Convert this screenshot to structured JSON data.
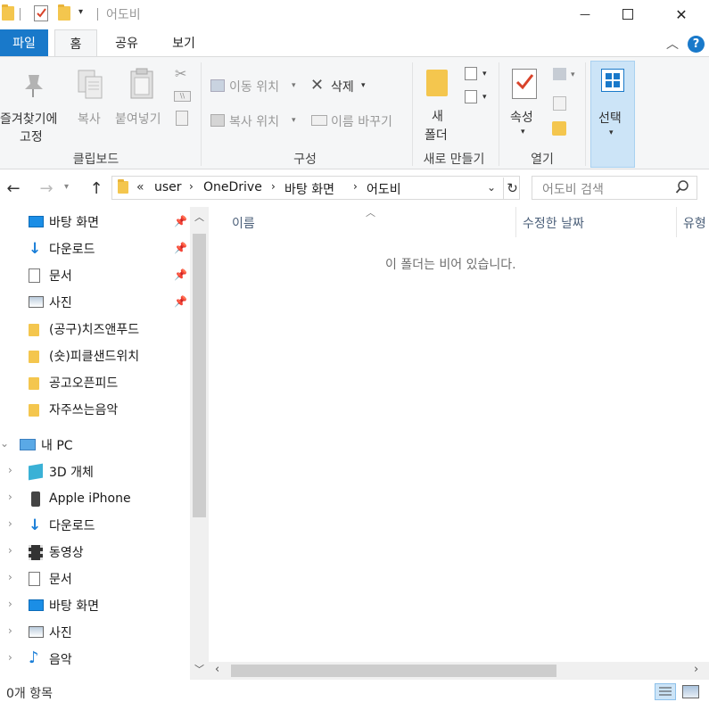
{
  "window": {
    "title": "어도비",
    "minimize_glyph": "—",
    "maximize_glyph": "☐",
    "close_glyph": "✕"
  },
  "tabs": {
    "file": "파일",
    "home": "홈",
    "share": "공유",
    "view": "보기"
  },
  "ribbon": {
    "clipboard": {
      "pin_quick": "즐겨찾기에",
      "pin_quick2": "고정",
      "copy": "복사",
      "paste": "붙여넣기",
      "group_label": "클립보드"
    },
    "organize": {
      "move_to": "이동 위치",
      "copy_to": "복사 위치",
      "delete": "삭제",
      "rename": "이름 바꾸기",
      "group_label": "구성"
    },
    "new": {
      "new_folder_1": "새",
      "new_folder_2": "폴더",
      "group_label": "새로 만들기"
    },
    "open": {
      "properties": "속성",
      "group_label": "열기"
    },
    "select": {
      "select": "선택"
    }
  },
  "address": {
    "overflow": "«",
    "crumbs": [
      "user",
      "OneDrive",
      "바탕 화면",
      "어도비"
    ],
    "search_placeholder": "어도비 검색"
  },
  "nav": {
    "quick": [
      {
        "label": "바탕 화면",
        "icon": "desktop-icon",
        "pinned": true
      },
      {
        "label": "다운로드",
        "icon": "download-icon",
        "pinned": true
      },
      {
        "label": "문서",
        "icon": "document-icon",
        "pinned": true
      },
      {
        "label": "사진",
        "icon": "pictures-icon",
        "pinned": true
      },
      {
        "label": "(공구)치즈앤푸드",
        "icon": "folder-icon",
        "pinned": false
      },
      {
        "label": "(숏)피클샌드위치",
        "icon": "folder-icon",
        "pinned": false
      },
      {
        "label": "공고오픈피드",
        "icon": "folder-icon",
        "pinned": false
      },
      {
        "label": "자주쓰는음악",
        "icon": "folder-icon",
        "pinned": false
      }
    ],
    "this_pc": "내 PC",
    "pc_items": [
      {
        "label": "3D 개체",
        "icon": "3d-objects-icon"
      },
      {
        "label": "Apple iPhone",
        "icon": "iphone-icon"
      },
      {
        "label": "다운로드",
        "icon": "download-icon"
      },
      {
        "label": "동영상",
        "icon": "video-icon"
      },
      {
        "label": "문서",
        "icon": "document-icon"
      },
      {
        "label": "바탕 화면",
        "icon": "desktop-icon"
      },
      {
        "label": "사진",
        "icon": "pictures-icon"
      },
      {
        "label": "음악",
        "icon": "music-icon"
      }
    ]
  },
  "content": {
    "col_name": "이름",
    "col_modified": "수정한 날짜",
    "col_type": "유형",
    "empty_message": "이 폴더는 비어 있습니다."
  },
  "status": {
    "item_count": "0개 항목"
  },
  "colors": {
    "accent": "#1979ca",
    "folder": "#f4c64e",
    "select_bg": "#cce4f7"
  }
}
